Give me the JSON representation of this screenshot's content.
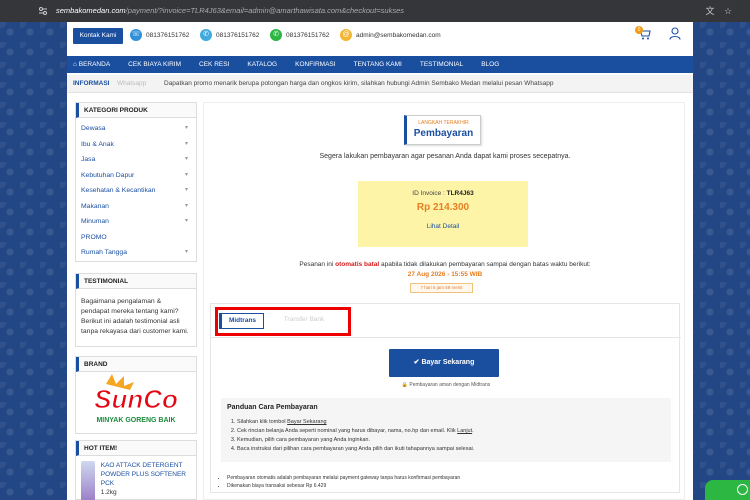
{
  "browser": {
    "url_domain": "sembakomedan.com",
    "url_rest": "/payment/?invoice=TLR4J63&email=admin@amarthawisata.com&checkout=sukses"
  },
  "topbar": {
    "kontak_label": "Kontak Kami",
    "phone1": "081376151762",
    "phone2": "081376151762",
    "phone3": "081376151762",
    "email": "admin@sembakomedan.com",
    "cart_count": "0"
  },
  "nav": {
    "items": [
      "BERANDA",
      "CEK BIAYA KIRIM",
      "CEK RESI",
      "KATALOG",
      "KONFIRMASI",
      "TENTANG KAMI",
      "TESTIMONIAL",
      "BLOG"
    ]
  },
  "info": {
    "label": "INFORMASI",
    "faded": "Whatsapp",
    "message": "Dapatkan promo menarik berupa potongan harga dan ongkos kirim, silahkan hubungi Admin Sembako Medan melalui pesan Whatsapp"
  },
  "sidebar": {
    "kategori_title": "KATEGORI PRODUK",
    "categories": [
      {
        "label": "Dewasa",
        "chev": "▾"
      },
      {
        "label": "Ibu & Anak",
        "chev": "▾"
      },
      {
        "label": "Jasa",
        "chev": "▾"
      },
      {
        "label": "Kebutuhan Dapur",
        "chev": "▾"
      },
      {
        "label": "Kesehatan & Kecantikan",
        "chev": "▾"
      },
      {
        "label": "Makanan",
        "chev": "▾"
      },
      {
        "label": "Minuman",
        "chev": "▾"
      },
      {
        "label": "PROMO",
        "chev": ""
      },
      {
        "label": "Rumah Tangga",
        "chev": "▾"
      }
    ],
    "testimonial_title": "TESTIMONIAL",
    "testimonial_text": "Bagaimana pengalaman & pendapat mereka tentang kami? Berikut ini adalah testimonial asli tanpa rekayasa dari customer kami.",
    "brand_title": "BRAND",
    "brand_logo_text": "SunCo",
    "brand_tagline": "MINYAK GORENG BAIK",
    "hot_title": "HOT ITEM!",
    "hot_item_name": "KAO ATTACK DETERGENT POWDER PLUS SOFTENER PCK",
    "hot_item_weight": "1.2kg"
  },
  "payment": {
    "step_small": "LANGKAH TERAKHIR",
    "step_title": "Pembayaran",
    "subtitle": "Segera lakukan pembayaran agar pesanan Anda dapat kami proses secepatnya.",
    "invoice_label": "ID Invoice : ",
    "invoice_id": "TLR4J63",
    "amount": "Rp 214.300",
    "detail_link": "Lihat Detail",
    "warn_pre": "Pesanan ini ",
    "warn_red": "otomatis batal",
    "warn_post": " apabila tidak dilakukan pembayaran sampai dengan batas waktu berikut:",
    "deadline": "27 Aug 2026 - 15:55 WIB",
    "countdown": "7 hari 6 jam 59 menit"
  },
  "tabs": {
    "active": "Midtrans",
    "inactive": "Transfer Bank"
  },
  "pay_button": "Bayar Sekarang",
  "secure_note": "Pembayaran aman dengan Midtrans",
  "guide": {
    "title": "Panduan Cara Pembayaran",
    "step1_pre": "Silahkan klik tombol ",
    "step1_link": "Bayar Sekarang",
    "step2_pre": "Cek rincian belanja Anda seperti nominal yang harus dibayar, nama, no.hp dan email. Klik ",
    "step2_link": "Lanjut",
    "step2_post": ".",
    "step3": "Kemudian, pilih cara pembayaran yang Anda inginkan.",
    "step4": "Baca instruksi dari pilihan cara pembayaran yang Anda pilih dan ikuti tahapannya sampai selesai."
  },
  "notes": {
    "note1": "Pembayaran otomatis adalah pembayaran melalui payment gateway tanpa harus konfirmasi pembayaran",
    "note2": "Dikenakan biaya transaksi sebesar Rp 6.429"
  },
  "colors": {
    "primary": "#1a4fa0",
    "accent": "#e67e22",
    "danger": "#e00000",
    "invoice_bg": "#fdf4a8"
  }
}
